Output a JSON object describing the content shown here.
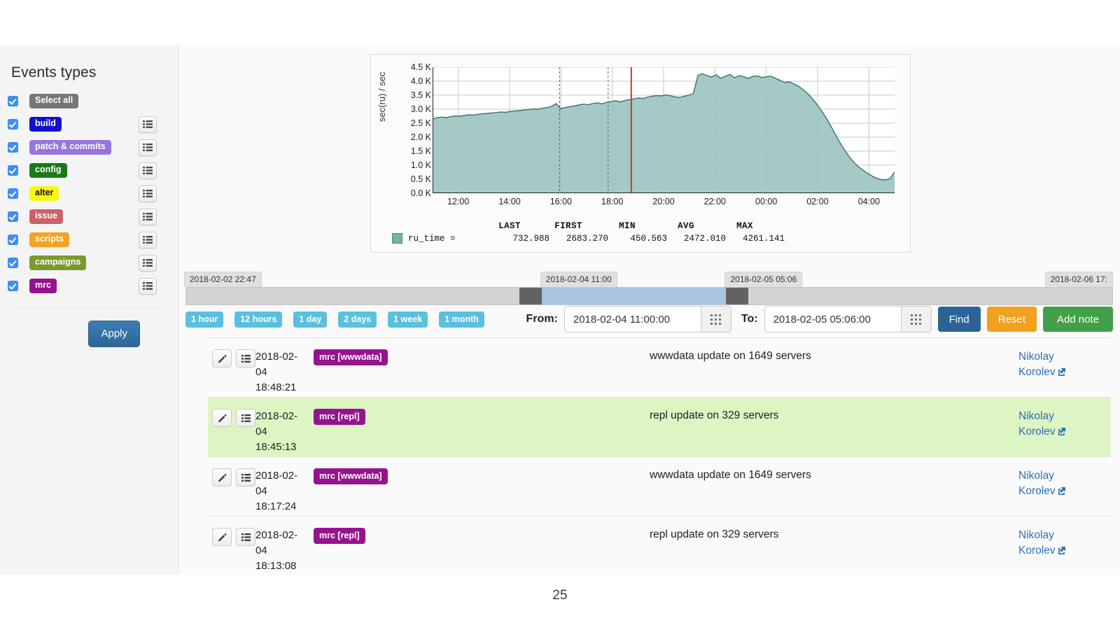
{
  "sidebar": {
    "title": "Events types",
    "apply_label": "Apply",
    "list_icon": "list-icon",
    "items": [
      {
        "label": "Select all",
        "color": "#777777",
        "text_color": "#ffffff",
        "checked": true,
        "has_list_button": false
      },
      {
        "label": "build",
        "color": "#1010cd",
        "text_color": "#ffffff",
        "checked": true,
        "has_list_button": true
      },
      {
        "label": "patch & commits",
        "color": "#9775dd",
        "text_color": "#ffffff",
        "checked": true,
        "has_list_button": true
      },
      {
        "label": "config",
        "color": "#1a7a1a",
        "text_color": "#ffffff",
        "checked": true,
        "has_list_button": true
      },
      {
        "label": "alter",
        "color": "#f8f815",
        "text_color": "#111111",
        "checked": true,
        "has_list_button": true
      },
      {
        "label": "issue",
        "color": "#c9636b",
        "text_color": "#ffffff",
        "checked": true,
        "has_list_button": true
      },
      {
        "label": "scripts",
        "color": "#f4a325",
        "text_color": "#ffffff",
        "checked": true,
        "has_list_button": true
      },
      {
        "label": "campaigns",
        "color": "#7a9a2e",
        "text_color": "#ffffff",
        "checked": true,
        "has_list_button": true
      },
      {
        "label": "mrc",
        "color": "#97128f",
        "text_color": "#ffffff",
        "checked": true,
        "has_list_button": true
      }
    ]
  },
  "chart_data": {
    "type": "area",
    "title": "",
    "xlabel": "",
    "ylabel": "sec(ru) / sec",
    "ylim": [
      0,
      4500
    ],
    "yticks": [
      "0.0 K",
      "0.5 K",
      "1.0 K",
      "1.5 K",
      "2.0 K",
      "2.5 K",
      "3.0 K",
      "3.5 K",
      "4.0 K",
      "4.5 K"
    ],
    "ytick_values": [
      0,
      500,
      1000,
      1500,
      2000,
      2500,
      3000,
      3500,
      4000,
      4500
    ],
    "xticks": [
      "12:00",
      "14:00",
      "16:00",
      "18:00",
      "20:00",
      "22:00",
      "00:00",
      "02:00",
      "04:00"
    ],
    "grid": true,
    "legend_position": "bottom",
    "series": [
      {
        "name": "ru_time",
        "color": "#9cc4c1",
        "line_color": "#3d6f6c",
        "x": [
          0,
          1,
          2,
          3,
          4,
          5,
          6,
          7,
          8,
          9,
          10,
          11,
          12,
          13,
          14,
          15,
          16,
          17,
          18,
          19,
          20,
          21,
          22,
          23,
          24,
          25,
          26,
          27,
          28,
          29,
          30,
          31,
          32,
          33,
          34,
          35,
          36,
          37,
          38,
          39,
          40,
          41,
          42,
          43,
          44,
          45,
          46,
          47,
          48,
          49,
          50,
          51,
          52,
          53,
          54,
          55,
          56,
          57,
          58,
          59,
          60,
          61,
          62,
          63,
          64,
          65,
          66,
          67,
          68,
          69,
          70,
          71,
          72,
          73,
          74,
          75,
          76,
          77,
          78,
          79,
          80,
          81,
          82,
          83,
          84,
          85,
          86,
          87,
          88,
          89,
          90,
          91,
          92,
          93,
          94,
          95,
          96,
          97,
          98,
          99,
          100
        ],
        "values": [
          2650,
          2700,
          2720,
          2700,
          2740,
          2760,
          2750,
          2780,
          2800,
          2790,
          2820,
          2840,
          2850,
          2870,
          2880,
          2900,
          2890,
          2920,
          2940,
          2950,
          2970,
          2990,
          3010,
          3000,
          3030,
          3060,
          3100,
          3200,
          3020,
          3060,
          3090,
          3120,
          3150,
          3180,
          3160,
          3200,
          3230,
          3190,
          3240,
          3270,
          3300,
          3260,
          3310,
          3340,
          3370,
          3400,
          3380,
          3430,
          3460,
          3490,
          3470,
          3510,
          3480,
          3440,
          3420,
          3460,
          3500,
          3560,
          4200,
          4270,
          4200,
          4150,
          4230,
          4100,
          4180,
          4240,
          4120,
          4200,
          4160,
          4100,
          4170,
          4190,
          4130,
          4160,
          4180,
          4100,
          4030,
          3950,
          3980,
          3900,
          3820,
          3700,
          3560,
          3380,
          3180,
          2950,
          2700,
          2420,
          2120,
          1820,
          1560,
          1320,
          1120,
          960,
          830,
          720,
          620,
          540,
          490,
          470,
          520,
          760
        ]
      }
    ],
    "legend_headers": [
      "LAST",
      "FIRST",
      "MIN",
      "AVG",
      "MAX"
    ],
    "legend_rows": [
      {
        "name": "ru_time =",
        "LAST": "732.988",
        "FIRST": "2683.270",
        "MIN": "450.563",
        "AVG": "2472.010",
        "MAX": "4261.141"
      }
    ],
    "markers": {
      "cursor_line_color": "#c0392b",
      "cursor_x_percent": 43,
      "dashed_lines_color": "#2e7d32",
      "dashed_x_percents": [
        27.5,
        38
      ]
    }
  },
  "timeline": {
    "left_label": "2018-02-02 22:47",
    "from_label": "2018-02-04 11:00",
    "to_label": "2018-02-05 05:06",
    "right_label": "2018-02-06 17:",
    "selection_start_percent": 38.4,
    "selection_end_percent": 58.3,
    "track_color": "#d4d4d4",
    "selection_color": "#aac4e0",
    "handle_color": "#636363"
  },
  "controls": {
    "quick_ranges": [
      "1 hour",
      "12 hours",
      "1 day",
      "2 days",
      "1 week",
      "1 month"
    ],
    "from_label": "From:",
    "from_value": "2018-02-04 11:00:00",
    "to_label": "To:",
    "to_value": "2018-02-05 05:06:00",
    "calendar_icon": "calendar-grid-icon",
    "find_label": "Find",
    "reset_label": "Reset",
    "add_note_label": "Add note",
    "find_color": "#2a6496",
    "reset_color": "#f0a11e",
    "add_note_color": "#41a048"
  },
  "events": {
    "edit_icon": "pencil-icon",
    "details_icon": "list-icon",
    "external_icon": "external-link-icon",
    "rows": [
      {
        "date": "2018-02-",
        "date2": "04",
        "time": "18:48:21",
        "tag": "mrc [wwwdata]",
        "message": "wwwdata update on 1649 servers",
        "user_first": "Nikolay",
        "user_last": "Korolev",
        "highlighted": false
      },
      {
        "date": "2018-02-",
        "date2": "04",
        "time": "18:45:13",
        "tag": "mrc [repl]",
        "message": "repl update on 329 servers",
        "user_first": "Nikolay",
        "user_last": "Korolev",
        "highlighted": true
      },
      {
        "date": "2018-02-",
        "date2": "04",
        "time": "18:17:24",
        "tag": "mrc [wwwdata]",
        "message": "wwwdata update on 1649 servers",
        "user_first": "Nikolay",
        "user_last": "Korolev",
        "highlighted": false
      },
      {
        "date": "2018-02-",
        "date2": "04",
        "time": "18:13:08",
        "tag": "mrc [repl]",
        "message": "repl update on 329 servers",
        "user_first": "Nikolay",
        "user_last": "Korolev",
        "highlighted": false
      }
    ]
  },
  "footer": {
    "page_number": "25"
  }
}
